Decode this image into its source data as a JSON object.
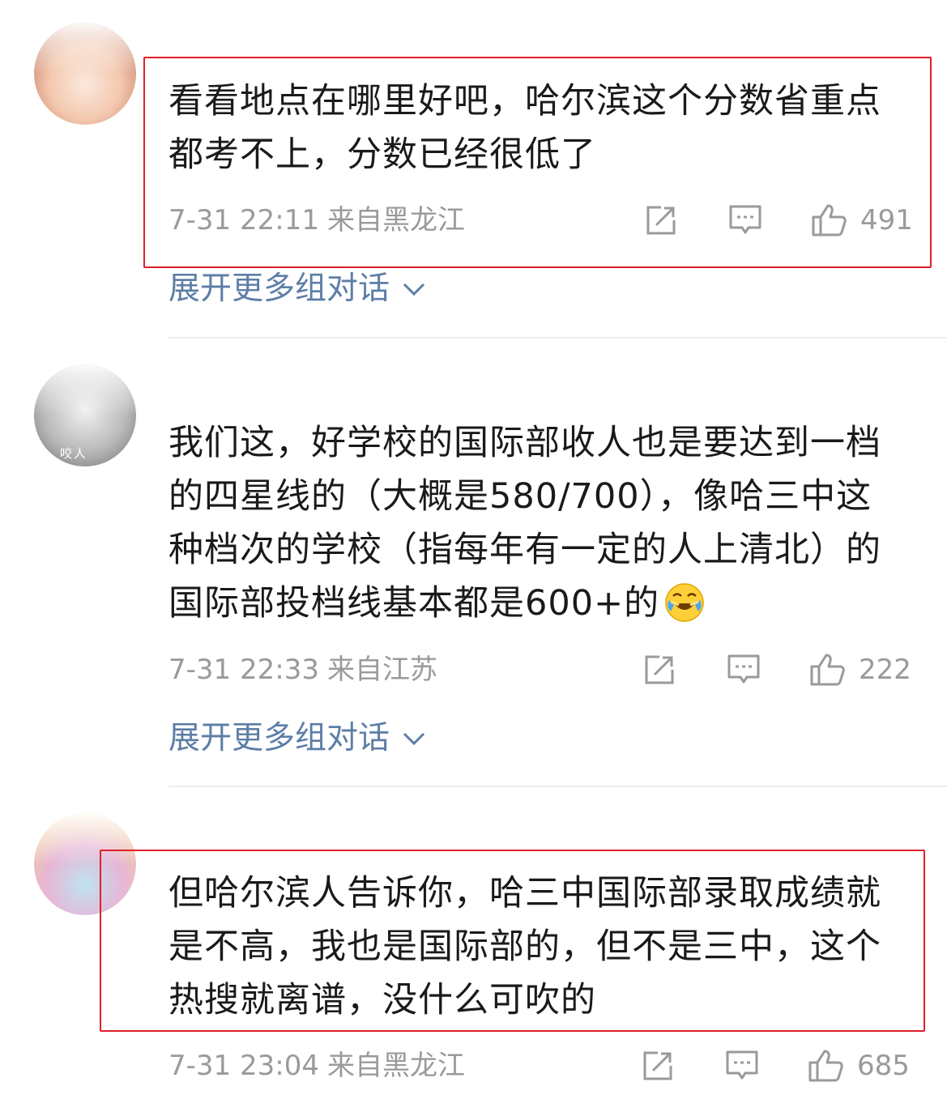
{
  "comments": [
    {
      "text_lines": [
        "看看地点在哪里好吧，哈尔滨这个分数省重点",
        "都考不上，分数已经很低了"
      ],
      "time": "7-31 22:11",
      "location": "来自黑龙江",
      "likes": "491",
      "expand_label": "展开更多组对话",
      "highlighted": true
    },
    {
      "text_lines": [
        "我们这，好学校的国际部收人也是要达到一档",
        "的四星线的（大概是580/700），像哈三中这",
        "种档次的学校（指每年有一定的人上清北）的",
        "国际部投档线基本都是600+的"
      ],
      "time": "7-31 22:33",
      "location": "来自江苏",
      "likes": "222",
      "expand_label": "展开更多组对话",
      "avatar_text": "咬人",
      "highlighted": false
    },
    {
      "text_lines": [
        "但哈尔滨人告诉你，哈三中国际部录取成绩就",
        "是不高，我也是国际部的，但不是三中，这个",
        "热搜就离谱，没什么可吹的"
      ],
      "time": "7-31 23:04",
      "location": "来自黑龙江",
      "likes": "685",
      "highlighted": true
    }
  ],
  "icons": {
    "share": "share-icon",
    "comment": "comment-icon",
    "like": "thumbs-up-icon",
    "expand": "chevron-down-icon",
    "emoji": "laugh-cry-emoji-icon"
  },
  "colors": {
    "text": "#1a1a1a",
    "meta": "#9a9a9a",
    "link": "#5d7ea6",
    "highlight_border": "#e0202a",
    "divider": "#ececec"
  }
}
